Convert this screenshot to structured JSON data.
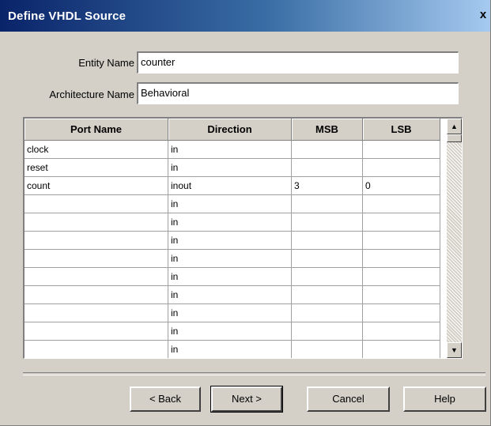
{
  "window": {
    "title": "Define VHDL Source",
    "close_label": "x"
  },
  "form": {
    "entity_label": "Entity Name",
    "entity_value": "counter",
    "architecture_label": "Architecture Name",
    "architecture_value": "Behavioral"
  },
  "table": {
    "columns": [
      "Port Name",
      "Direction",
      "MSB",
      "LSB"
    ],
    "rows": [
      [
        "clock",
        "in",
        "",
        ""
      ],
      [
        "reset",
        "in",
        "",
        ""
      ],
      [
        "count",
        "inout",
        "3",
        "0"
      ],
      [
        "",
        "in",
        "",
        ""
      ],
      [
        "",
        "in",
        "",
        ""
      ],
      [
        "",
        "in",
        "",
        ""
      ],
      [
        "",
        "in",
        "",
        ""
      ],
      [
        "",
        "in",
        "",
        ""
      ],
      [
        "",
        "in",
        "",
        ""
      ],
      [
        "",
        "in",
        "",
        ""
      ],
      [
        "",
        "in",
        "",
        ""
      ],
      [
        "",
        "in",
        "",
        ""
      ]
    ]
  },
  "scrollbar": {
    "up_icon": "triangle-up-icon",
    "down_icon": "triangle-down-icon"
  },
  "buttons": {
    "back": "< Back",
    "next": "Next >",
    "cancel": "Cancel",
    "help": "Help"
  }
}
